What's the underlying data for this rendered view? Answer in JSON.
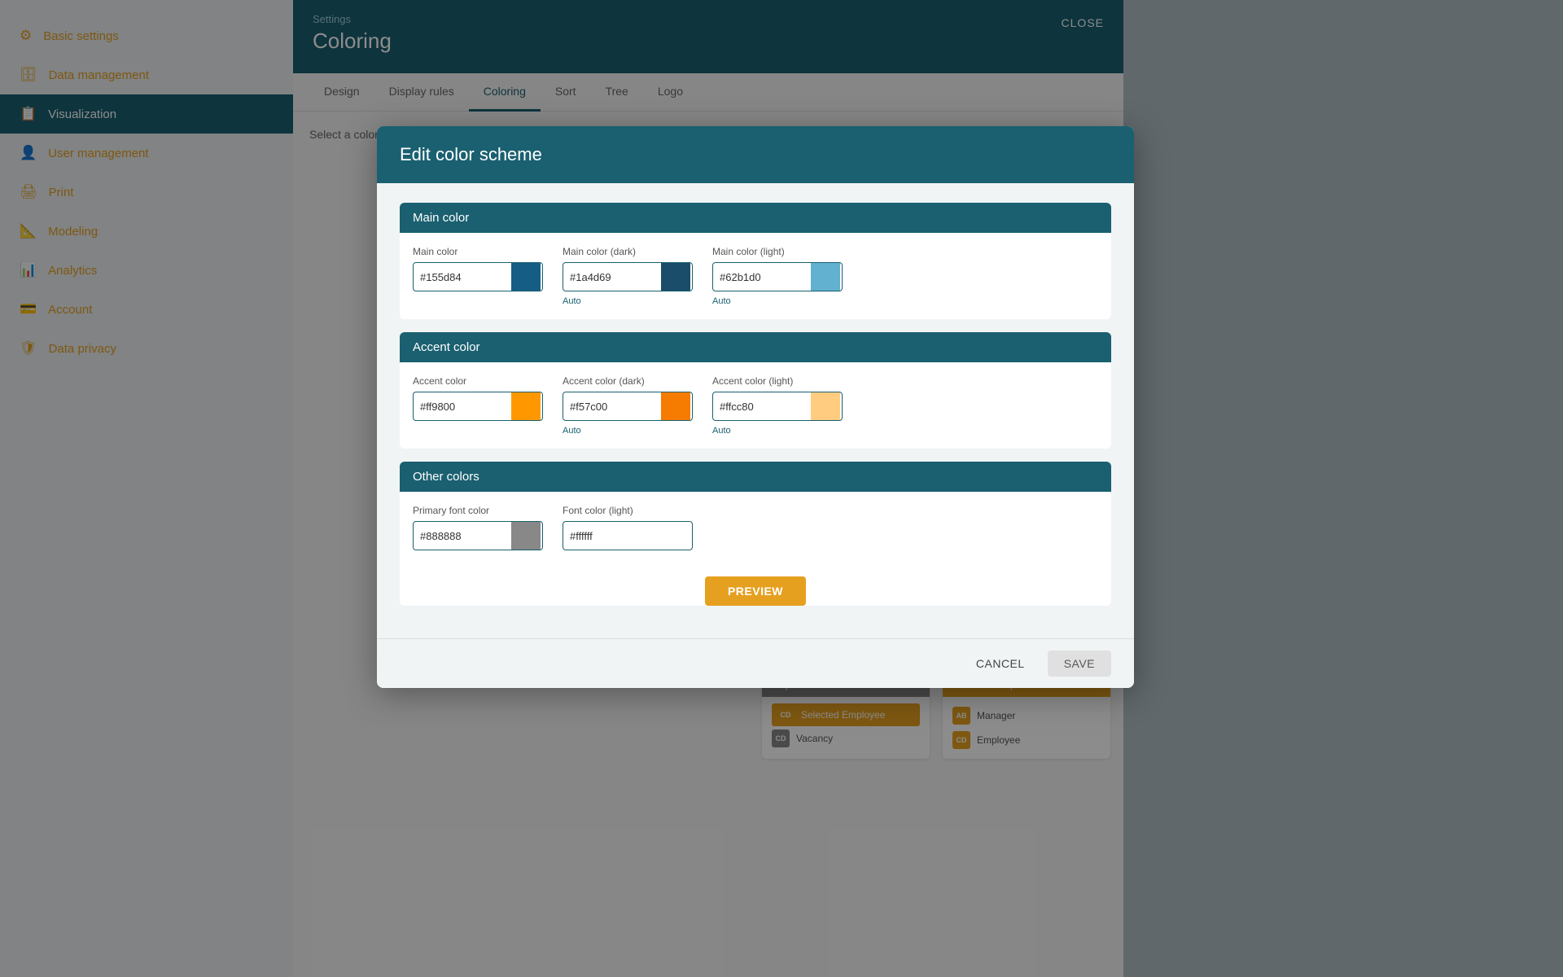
{
  "sidebar": {
    "items": [
      {
        "id": "basic-settings",
        "label": "Basic settings",
        "icon": "⚙"
      },
      {
        "id": "data-management",
        "label": "Data management",
        "icon": "🗄"
      },
      {
        "id": "visualization",
        "label": "Visualization",
        "icon": "📋",
        "active": true
      },
      {
        "id": "user-management",
        "label": "User management",
        "icon": "👤"
      },
      {
        "id": "print",
        "label": "Print",
        "icon": "🖨"
      },
      {
        "id": "modeling",
        "label": "Modeling",
        "icon": "📐"
      },
      {
        "id": "analytics",
        "label": "Analytics",
        "icon": "📊"
      },
      {
        "id": "account",
        "label": "Account",
        "icon": "💳"
      },
      {
        "id": "data-privacy",
        "label": "Data privacy",
        "icon": "🛡"
      }
    ]
  },
  "settings": {
    "breadcrumb": "Settings",
    "title": "Coloring",
    "close_label": "CLOSE"
  },
  "tabs": [
    {
      "id": "design",
      "label": "Design"
    },
    {
      "id": "display-rules",
      "label": "Display rules"
    },
    {
      "id": "coloring",
      "label": "Coloring",
      "active": true
    },
    {
      "id": "sort",
      "label": "Sort"
    },
    {
      "id": "tree",
      "label": "Tree"
    },
    {
      "id": "logo",
      "label": "Logo"
    }
  ],
  "tab_description": "Select a color scheme for the application",
  "modal": {
    "title": "Edit color scheme",
    "sections": [
      {
        "id": "main-color",
        "title": "Main color",
        "fields": [
          {
            "id": "main-color",
            "label": "Main color",
            "value": "#155d84",
            "swatch": "#155d84",
            "auto": false
          },
          {
            "id": "main-color-dark",
            "label": "Main color (dark)",
            "value": "#1a4d69",
            "swatch": "#1a4d69",
            "auto": true
          },
          {
            "id": "main-color-light",
            "label": "Main color (light)",
            "value": "#62b1d0",
            "swatch": "#62b1d0",
            "auto": true
          }
        ]
      },
      {
        "id": "accent-color",
        "title": "Accent color",
        "fields": [
          {
            "id": "accent-color",
            "label": "Accent color",
            "value": "#ff9800",
            "swatch": "#ff9800",
            "auto": false
          },
          {
            "id": "accent-color-dark",
            "label": "Accent color (dark)",
            "value": "#f57c00",
            "swatch": "#f57c00",
            "auto": true
          },
          {
            "id": "accent-color-light",
            "label": "Accent color (light)",
            "value": "#ffcc80",
            "swatch": "#ffcc80",
            "auto": true
          }
        ]
      },
      {
        "id": "other-colors",
        "title": "Other colors",
        "fields": [
          {
            "id": "primary-font-color",
            "label": "Primary font color",
            "value": "#888888",
            "swatch": "#888888",
            "auto": false
          },
          {
            "id": "font-color-light",
            "label": "Font color (light)",
            "value": "#ffffff",
            "swatch": "#ffffff",
            "auto": false
          }
        ]
      }
    ],
    "preview_label": "PREVIEW",
    "cancel_label": "CANCEL",
    "save_label": "SAVE"
  },
  "preview": {
    "dept_cards": [
      {
        "header": "Department",
        "header_type": "grey",
        "rows": [
          {
            "badge": "CD",
            "badge_type": "orange",
            "label": "Selected Employee",
            "selected": true
          },
          {
            "badge": "CD",
            "badge_type": "grey",
            "label": "Vacancy",
            "selected": false
          }
        ]
      },
      {
        "header": "Selected Department",
        "header_type": "orange",
        "rows": [
          {
            "badge": "AB",
            "badge_type": "orange",
            "label": "Manager",
            "selected": false
          },
          {
            "badge": "CD",
            "badge_type": "orange",
            "label": "Employee",
            "selected": false
          }
        ]
      }
    ]
  }
}
